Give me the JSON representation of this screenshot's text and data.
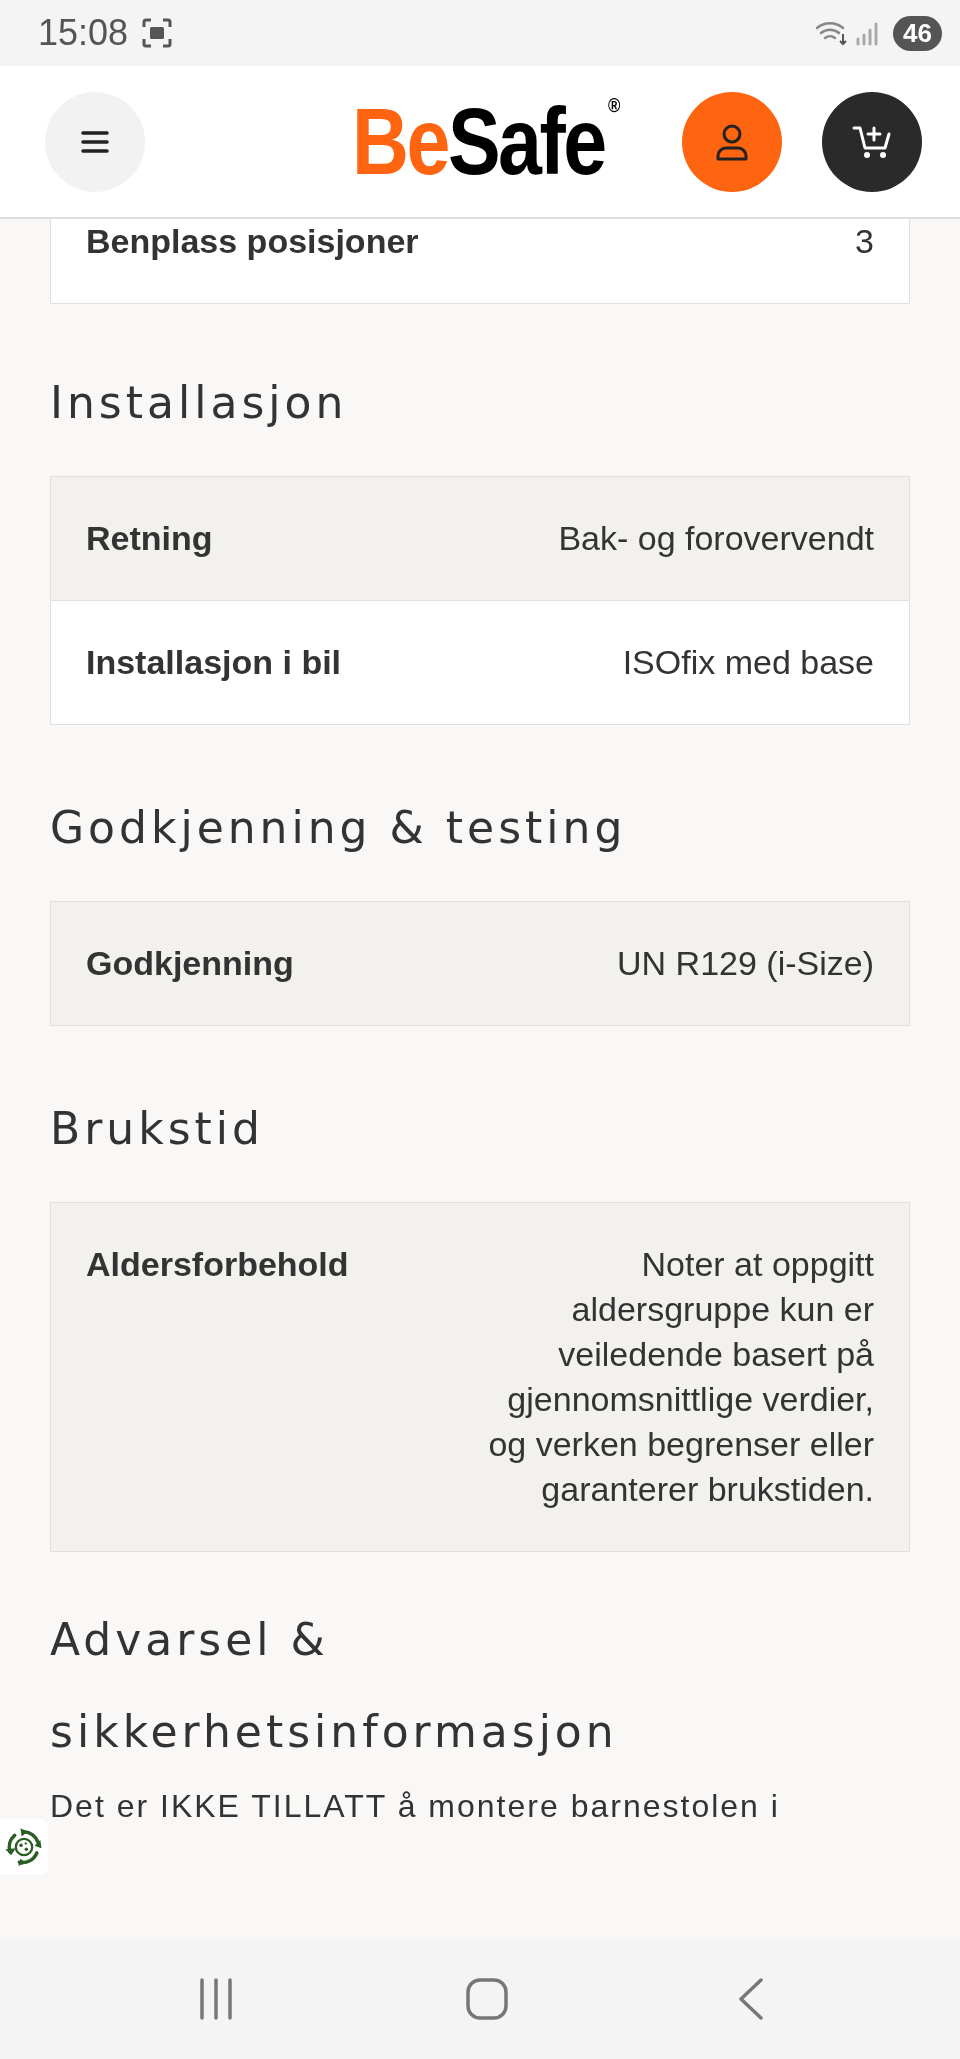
{
  "status_bar": {
    "time": "15:08",
    "battery": "46"
  },
  "header": {
    "logo": {
      "part_1": "Be",
      "part_2": "Safe",
      "mark": "®"
    }
  },
  "sections": [
    {
      "rows": [
        {
          "label": "Benplass posisjoner",
          "value": "3"
        }
      ]
    },
    {
      "title": "Installasjon",
      "rows": [
        {
          "label": "Retning",
          "value": "Bak- og forovervendt"
        },
        {
          "label": "Installasjon i bil",
          "value": "ISOfix med base"
        }
      ]
    },
    {
      "title": "Godkjenning & testing",
      "rows": [
        {
          "label": "Godkjenning",
          "value": "UN R129 (i-Size)"
        }
      ]
    },
    {
      "title": "Brukstid",
      "rows": [
        {
          "label": "Aldersforbehold",
          "value": "Noter at oppgitt aldersgruppe kun er veiledende basert på gjennomsnittlige verdier, og verken begrenser eller garanterer brukstiden."
        }
      ]
    },
    {
      "title": "Advarsel & sikkerhetsinformasjon",
      "paragraph": "Det er IKKE TILLATT å montere barnestolen i"
    }
  ]
}
